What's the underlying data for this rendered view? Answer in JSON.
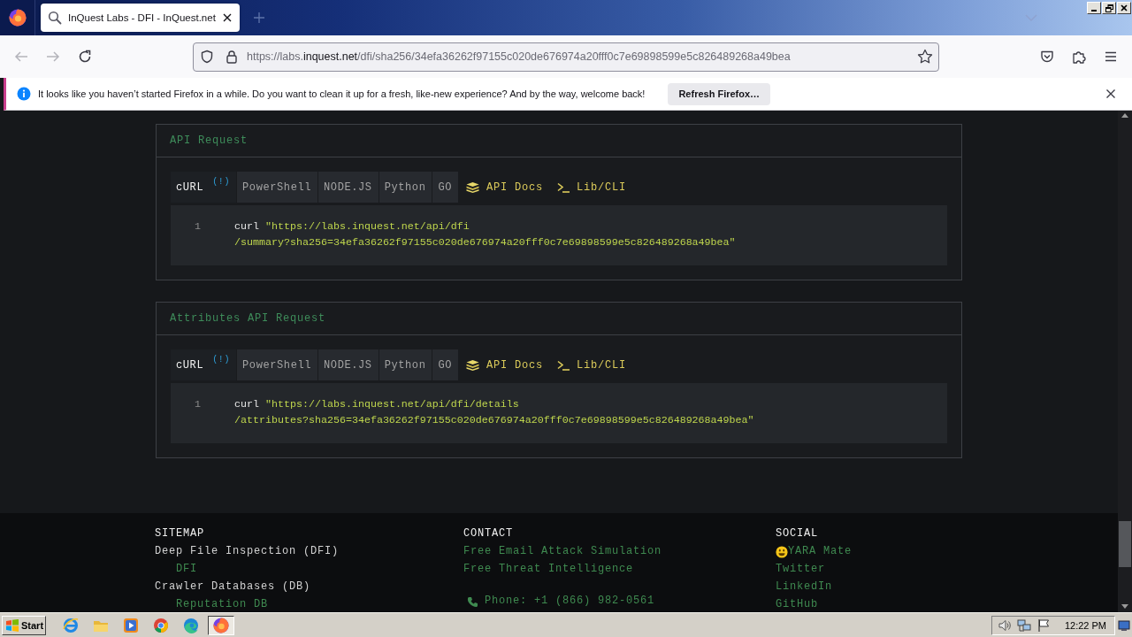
{
  "browser": {
    "tabs": [
      {
        "title": "InQuest Labs - DFI - InQuest.net",
        "selected": true
      }
    ],
    "url": "https://labs.**inquest.net**/dfi/sha256/34efa36262f97155c020de676974a20fff0c7e69898599e5c826489268a49bea",
    "notification": {
      "message": "It looks like you haven’t started Firefox in a while. Do you want to clean it up for a fresh, like-new experience? And by the way, welcome back!",
      "button": "Refresh Firefox…"
    }
  },
  "panels": [
    {
      "title": "API Request",
      "tabs": [
        {
          "label": "cURL",
          "badge": "(!)",
          "selected": true
        },
        {
          "label": "PowerShell",
          "selected": false
        },
        {
          "label": "NODE.JS",
          "selected": false
        },
        {
          "label": "Python",
          "selected": false
        },
        {
          "label": "GO",
          "selected": false
        }
      ],
      "links": [
        {
          "kind": "docs",
          "label": "API Docs"
        },
        {
          "kind": "cli",
          "label": "Lib/CLI"
        }
      ],
      "code": {
        "line_number": "1",
        "command": "curl",
        "argument_lines": [
          "\"https://labs.inquest.net/api/dfi",
          "/summary?sha256=34efa36262f97155c020de676974a20fff0c7e69898599e5c826489268a49bea\""
        ]
      }
    },
    {
      "title": "Attributes API Request",
      "tabs": [
        {
          "label": "cURL",
          "badge": "(!)",
          "selected": true
        },
        {
          "label": "PowerShell",
          "selected": false
        },
        {
          "label": "NODE.JS",
          "selected": false
        },
        {
          "label": "Python",
          "selected": false
        },
        {
          "label": "GO",
          "selected": false
        }
      ],
      "links": [
        {
          "kind": "docs",
          "label": "API Docs"
        },
        {
          "kind": "cli",
          "label": "Lib/CLI"
        }
      ],
      "code": {
        "line_number": "1",
        "command": "curl",
        "argument_lines": [
          "\"https://labs.inquest.net/api/dfi/details",
          "/attributes?sha256=34efa36262f97155c020de676974a20fff0c7e69898599e5c826489268a49bea\""
        ]
      }
    }
  ],
  "footer": {
    "columns": [
      {
        "heading": "SITEMAP",
        "items": [
          {
            "kind": "category",
            "label": "Deep File Inspection (DFI)"
          },
          {
            "kind": "sublink",
            "label": "DFI"
          },
          {
            "kind": "category",
            "label": "Crawler Databases (DB)"
          },
          {
            "kind": "sublink",
            "label": "Reputation DB"
          }
        ]
      },
      {
        "heading": "CONTACT",
        "items": [
          {
            "kind": "link",
            "label": "Free Email Attack Simulation"
          },
          {
            "kind": "link",
            "label": "Free Threat Intelligence"
          },
          {
            "kind": "phone",
            "label": "Phone: +1 (866) 982-0561"
          }
        ]
      },
      {
        "heading": "SOCIAL",
        "items": [
          {
            "kind": "emoji-link",
            "label": "YARA Mate"
          },
          {
            "kind": "link",
            "label": "Twitter"
          },
          {
            "kind": "link",
            "label": "LinkedIn"
          },
          {
            "kind": "link",
            "label": "GitHub"
          }
        ]
      }
    ]
  },
  "taskbar": {
    "start": "Start",
    "apps": [
      {
        "kind": "ie",
        "selected": false
      },
      {
        "kind": "folder",
        "selected": false
      },
      {
        "kind": "media",
        "selected": false
      },
      {
        "kind": "chrome",
        "selected": false
      },
      {
        "kind": "edge",
        "selected": false
      },
      {
        "kind": "firefox",
        "selected": true
      }
    ],
    "clock": "12:22 PM"
  }
}
